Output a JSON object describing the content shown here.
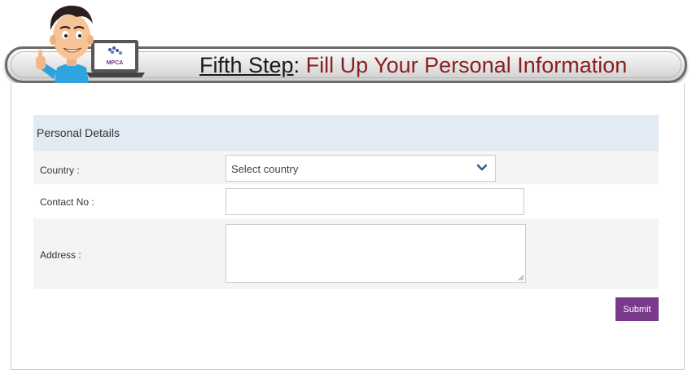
{
  "header": {
    "step_label": "Fifth Step",
    "colon": ":",
    "title": "Fill Up Your Personal Information",
    "laptop_logo_text": "MPCA"
  },
  "form": {
    "section_title": "Personal Details",
    "country_label": "Country :",
    "country_selected": "Select country",
    "contact_label": "Contact No :",
    "contact_value": "",
    "address_label": "Address :",
    "address_value": "",
    "submit_label": "Submit"
  },
  "colors": {
    "title_red": "#8b1e1e",
    "section_bg": "#e2ebf3",
    "row_grey": "#f4f4f4",
    "submit_purple": "#7a3a8c",
    "chevron_blue": "#2b5d9b"
  },
  "icons": [
    "mascot-illustration",
    "laptop-logo",
    "chevron-down-icon",
    "resize-grip-icon"
  ]
}
